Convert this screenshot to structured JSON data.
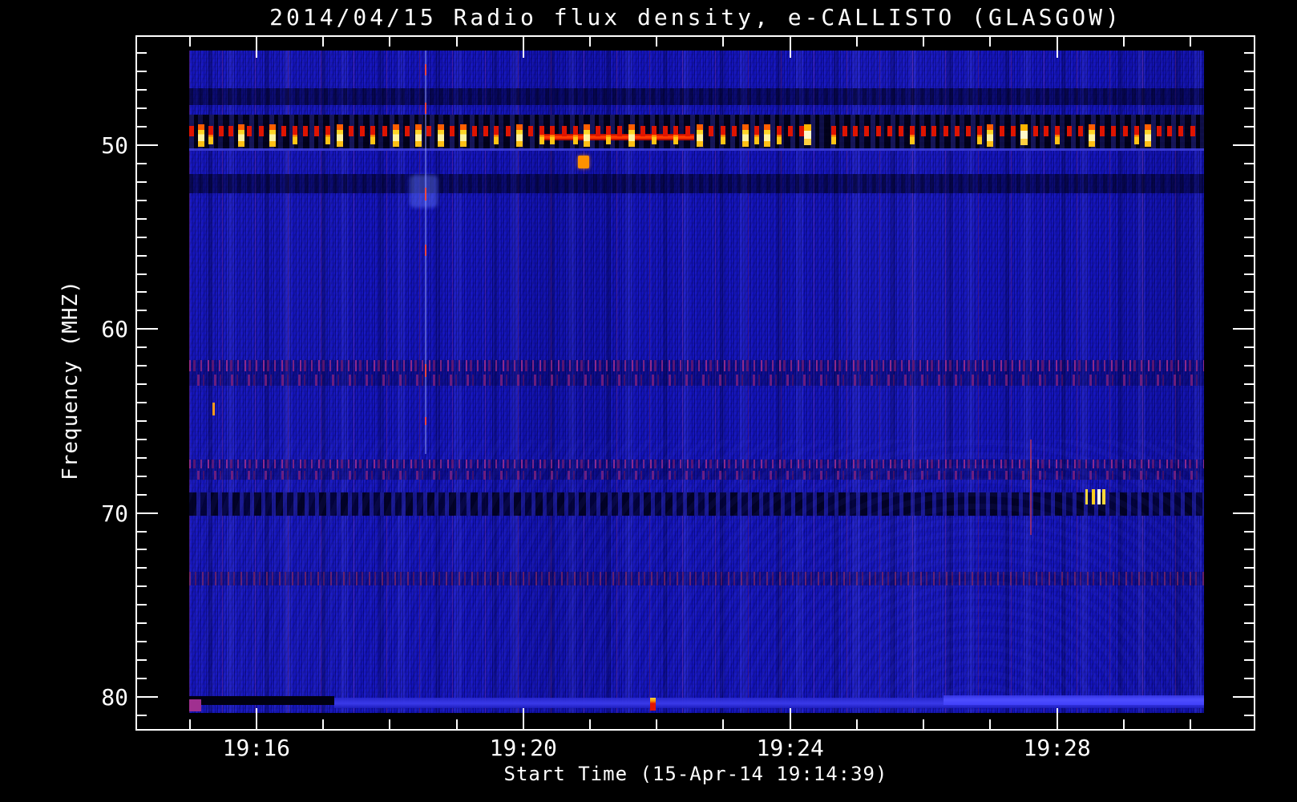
{
  "chart_data": {
    "type": "heatmap",
    "subtype": "radio-spectrogram",
    "title": "2014/04/15  Radio flux density, e-CALLISTO (GLASGOW)",
    "xlabel": "Start Time (15-Apr-14 19:14:39)",
    "ylabel": "Frequency (MHZ)",
    "station": "GLASGOW",
    "date": "2014/04/15",
    "start_time": "19:14:39",
    "legend": "none",
    "grid": "off",
    "x_axis": {
      "tick_labels": [
        "19:16",
        "19:20",
        "19:24",
        "19:28"
      ],
      "major_ticks_min_after_1914": [
        2,
        6,
        10,
        14
      ],
      "minor_tick_step_min": 1,
      "minor_ticks_range": [
        1,
        16
      ],
      "range_min_after_1914": [
        0.2,
        16.96
      ]
    },
    "y_axis": {
      "tick_labels": [
        "50",
        "60",
        "70",
        "80"
      ],
      "major_ticks_mhz": [
        50,
        60,
        70,
        80
      ],
      "minor_tick_step_mhz": 1,
      "minor_ticks_range": [
        45,
        81
      ],
      "range_mhz": [
        44.07,
        81.79
      ],
      "direction": "increasing-downward"
    },
    "data_extent": {
      "t_min_after_1914": [
        0.99,
        16.2
      ],
      "f_mhz": [
        44.85,
        80.87
      ]
    },
    "colormap": {
      "background_blue": "#1414bc",
      "stripe_dark": "#0b0b9a",
      "stripe_light": "#2d2dd8",
      "rfi_red": "#e01400",
      "rfi_orange": "#ff9100",
      "rfi_yellow": "#ffd31e",
      "rfi_pale": "#fff6b4",
      "speckle_purple": "#a02d8c",
      "hairline_red": "#c03060",
      "frame_white": "#ffffff"
    },
    "bands": [
      {
        "kind": "shade_dark",
        "f": [
          46.9,
          47.8
        ]
      },
      {
        "kind": "rfi_bed",
        "f": [
          48.35,
          50.3
        ]
      },
      {
        "kind": "shade_dark",
        "f": [
          51.55,
          52.6
        ]
      },
      {
        "kind": "speckle2",
        "f": [
          61.7,
          63.1
        ]
      },
      {
        "kind": "speckle2",
        "f": [
          67.1,
          68.2
        ]
      },
      {
        "kind": "dark_dashed",
        "f": [
          68.9,
          70.15
        ]
      },
      {
        "kind": "speckle1",
        "f": [
          73.2,
          73.95
        ]
      }
    ],
    "features": [
      {
        "kind": "red_line",
        "t": [
          6.32,
          8.56
        ],
        "f": [
          49.38,
          49.72
        ]
      },
      {
        "kind": "orange_blob",
        "t": [
          6.82,
          6.99
        ],
        "f": [
          50.55,
          51.25
        ]
      },
      {
        "kind": "light_patch",
        "t": [
          4.3,
          4.72
        ],
        "f": [
          51.6,
          53.4
        ]
      },
      {
        "kind": "vline_blue",
        "t": 4.52,
        "f": [
          44.85,
          66.8
        ],
        "red_dashes_f": [
          [
            45.6,
            46.2
          ],
          [
            47.7,
            48.3
          ],
          [
            52.3,
            53.0
          ],
          [
            55.4,
            56.0
          ],
          [
            61.9,
            62.6
          ],
          [
            64.8,
            65.2
          ]
        ]
      },
      {
        "kind": "vline_red",
        "t": 13.6,
        "f": [
          66.0,
          71.2
        ]
      },
      {
        "kind": "orange_tick",
        "t": 1.34,
        "f": [
          64.0,
          64.7
        ]
      },
      {
        "kind": "yellow_spots",
        "t": [
          14.42,
          14.75
        ],
        "f": [
          68.7,
          69.55
        ]
      },
      {
        "kind": "black_band",
        "t": [
          0.99,
          3.17
        ],
        "f": [
          79.95,
          80.45
        ]
      },
      {
        "kind": "light_band",
        "t": [
          3.17,
          16.2
        ],
        "f": [
          80.05,
          80.6
        ]
      },
      {
        "kind": "light_band_bright",
        "t": [
          12.3,
          16.2
        ],
        "f": [
          79.9,
          80.45
        ]
      },
      {
        "kind": "magenta_blob",
        "t": [
          0.99,
          1.17
        ],
        "f": [
          80.15,
          80.8
        ]
      },
      {
        "kind": "red_dot",
        "t": [
          7.9,
          7.99
        ],
        "f": [
          80.05,
          80.75
        ]
      }
    ],
    "rfi_pulses_50mhz": {
      "f_top_mhz": 48.88,
      "kinds": {
        "r": "red",
        "R": "wide-red",
        "y": "red-with-yellow-tail",
        "Y": "bright-yellow-tall",
        "w": "pale-white-yellow"
      },
      "pulses": [
        [
          1.03,
          "r"
        ],
        [
          1.17,
          "Y"
        ],
        [
          1.32,
          "y"
        ],
        [
          1.47,
          "r"
        ],
        [
          1.62,
          "r"
        ],
        [
          1.77,
          "Y"
        ],
        [
          1.9,
          "r"
        ],
        [
          2.07,
          "r"
        ],
        [
          2.24,
          "Y"
        ],
        [
          2.41,
          "r"
        ],
        [
          2.58,
          "y"
        ],
        [
          2.73,
          "r"
        ],
        [
          2.9,
          "r"
        ],
        [
          3.07,
          "y"
        ],
        [
          3.25,
          "Y"
        ],
        [
          3.42,
          "r"
        ],
        [
          3.59,
          "r"
        ],
        [
          3.75,
          "y"
        ],
        [
          3.92,
          "r"
        ],
        [
          4.09,
          "Y"
        ],
        [
          4.26,
          "r"
        ],
        [
          4.43,
          "Y"
        ],
        [
          4.59,
          "r"
        ],
        [
          4.76,
          "Y"
        ],
        [
          4.93,
          "r"
        ],
        [
          5.1,
          "Y"
        ],
        [
          5.27,
          "r"
        ],
        [
          5.44,
          "r"
        ],
        [
          5.6,
          "y"
        ],
        [
          5.77,
          "r"
        ],
        [
          5.94,
          "Y"
        ],
        [
          6.11,
          "r"
        ],
        [
          6.28,
          "y"
        ],
        [
          6.44,
          "y"
        ],
        [
          6.61,
          "r"
        ],
        [
          6.78,
          "y"
        ],
        [
          6.95,
          "Y"
        ],
        [
          7.12,
          "r"
        ],
        [
          7.28,
          "y"
        ],
        [
          7.45,
          "r"
        ],
        [
          7.62,
          "Y"
        ],
        [
          7.79,
          "r"
        ],
        [
          7.96,
          "y"
        ],
        [
          8.13,
          "r"
        ],
        [
          8.29,
          "y"
        ],
        [
          8.46,
          "r"
        ],
        [
          8.65,
          "Y"
        ],
        [
          8.82,
          "r"
        ],
        [
          8.99,
          "y"
        ],
        [
          9.16,
          "r"
        ],
        [
          9.33,
          "Y"
        ],
        [
          9.5,
          "y"
        ],
        [
          9.66,
          "Y"
        ],
        [
          9.83,
          "y"
        ],
        [
          10.0,
          "r"
        ],
        [
          10.17,
          "r"
        ],
        [
          10.26,
          "w"
        ],
        [
          10.65,
          "y"
        ],
        [
          10.82,
          "r"
        ],
        [
          10.98,
          "r"
        ],
        [
          11.15,
          "r"
        ],
        [
          11.32,
          "r"
        ],
        [
          11.49,
          "r"
        ],
        [
          11.66,
          "r"
        ],
        [
          11.83,
          "y"
        ],
        [
          12.0,
          "r"
        ],
        [
          12.16,
          "r"
        ],
        [
          12.33,
          "r"
        ],
        [
          12.5,
          "r"
        ],
        [
          12.67,
          "r"
        ],
        [
          12.84,
          "y"
        ],
        [
          13.0,
          "Y"
        ],
        [
          13.17,
          "r"
        ],
        [
          13.34,
          "r"
        ],
        [
          13.51,
          "w"
        ],
        [
          13.68,
          "r"
        ],
        [
          13.84,
          "r"
        ],
        [
          14.01,
          "y"
        ],
        [
          14.18,
          "r"
        ],
        [
          14.35,
          "r"
        ],
        [
          14.52,
          "Y"
        ],
        [
          14.68,
          "r"
        ],
        [
          14.85,
          "r"
        ],
        [
          15.02,
          "r"
        ],
        [
          15.19,
          "y"
        ],
        [
          15.36,
          "Y"
        ],
        [
          15.53,
          "r"
        ],
        [
          15.69,
          "r"
        ],
        [
          15.86,
          "r"
        ],
        [
          16.03,
          "r"
        ]
      ]
    }
  }
}
